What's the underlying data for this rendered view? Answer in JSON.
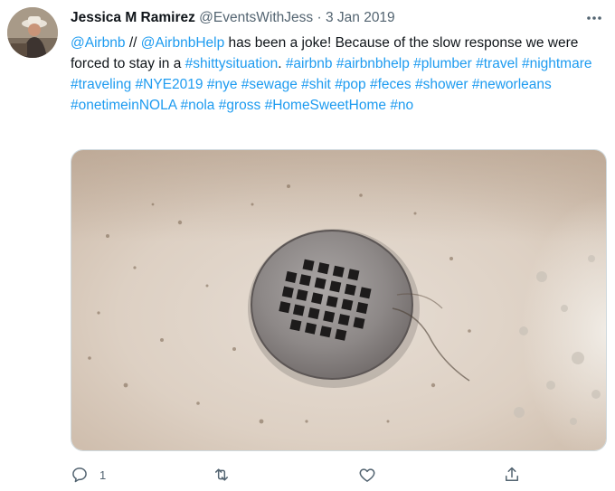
{
  "tweet": {
    "author_name": "Jessica M Ramirez",
    "handle": "@EventsWithJess",
    "separator": "·",
    "date": "3 Jan 2019",
    "segments": [
      {
        "text": "@Airbnb",
        "link": true
      },
      {
        "text": " // ",
        "link": false
      },
      {
        "text": "@AirbnbHelp",
        "link": true
      },
      {
        "text": " has been a joke! Because of the slow response we were forced to stay in a ",
        "link": false
      },
      {
        "text": "#shittysituation",
        "link": true
      },
      {
        "text": ". ",
        "link": false
      },
      {
        "text": "#airbnb",
        "link": true
      },
      {
        "text": " ",
        "link": false
      },
      {
        "text": "#airbnbhelp",
        "link": true
      },
      {
        "text": " ",
        "link": false
      },
      {
        "text": "#plumber",
        "link": true
      },
      {
        "text": " ",
        "link": false
      },
      {
        "text": "#travel",
        "link": true
      },
      {
        "text": " ",
        "link": false
      },
      {
        "text": "#nightmare",
        "link": true
      },
      {
        "text": " ",
        "link": false
      },
      {
        "text": "#traveling",
        "link": true
      },
      {
        "text": " ",
        "link": false
      },
      {
        "text": "#NYE2019",
        "link": true
      },
      {
        "text": " ",
        "link": false
      },
      {
        "text": "#nye",
        "link": true
      },
      {
        "text": " ",
        "link": false
      },
      {
        "text": "#sewage",
        "link": true
      },
      {
        "text": " ",
        "link": false
      },
      {
        "text": "#shit",
        "link": true
      },
      {
        "text": " ",
        "link": false
      },
      {
        "text": "#pop",
        "link": true
      },
      {
        "text": " ",
        "link": false
      },
      {
        "text": "#feces",
        "link": true
      },
      {
        "text": " ",
        "link": false
      },
      {
        "text": "#shower",
        "link": true
      },
      {
        "text": " ",
        "link": false
      },
      {
        "text": "#neworleans",
        "link": true
      },
      {
        "text": " ",
        "link": false
      },
      {
        "text": "#onetimeinNOLA",
        "link": true
      },
      {
        "text": " ",
        "link": false
      },
      {
        "text": "#nola",
        "link": true
      },
      {
        "text": " ",
        "link": false
      },
      {
        "text": "#gross",
        "link": true
      },
      {
        "text": " ",
        "link": false
      },
      {
        "text": "#HomeSweetHome",
        "link": true
      },
      {
        "text": " ",
        "link": false
      },
      {
        "text": "#no",
        "link": true
      }
    ],
    "media_icon": "shower-drain-photo",
    "actions": {
      "reply_icon": "reply-icon",
      "reply_count": "1",
      "retweet_icon": "retweet-icon",
      "like_icon": "like-icon",
      "share_icon": "share-icon"
    },
    "more_icon": "more-icon"
  },
  "colors": {
    "link": "#1d9bf0",
    "text": "#0f1419",
    "secondary": "#536471",
    "border": "#cfd9de"
  }
}
